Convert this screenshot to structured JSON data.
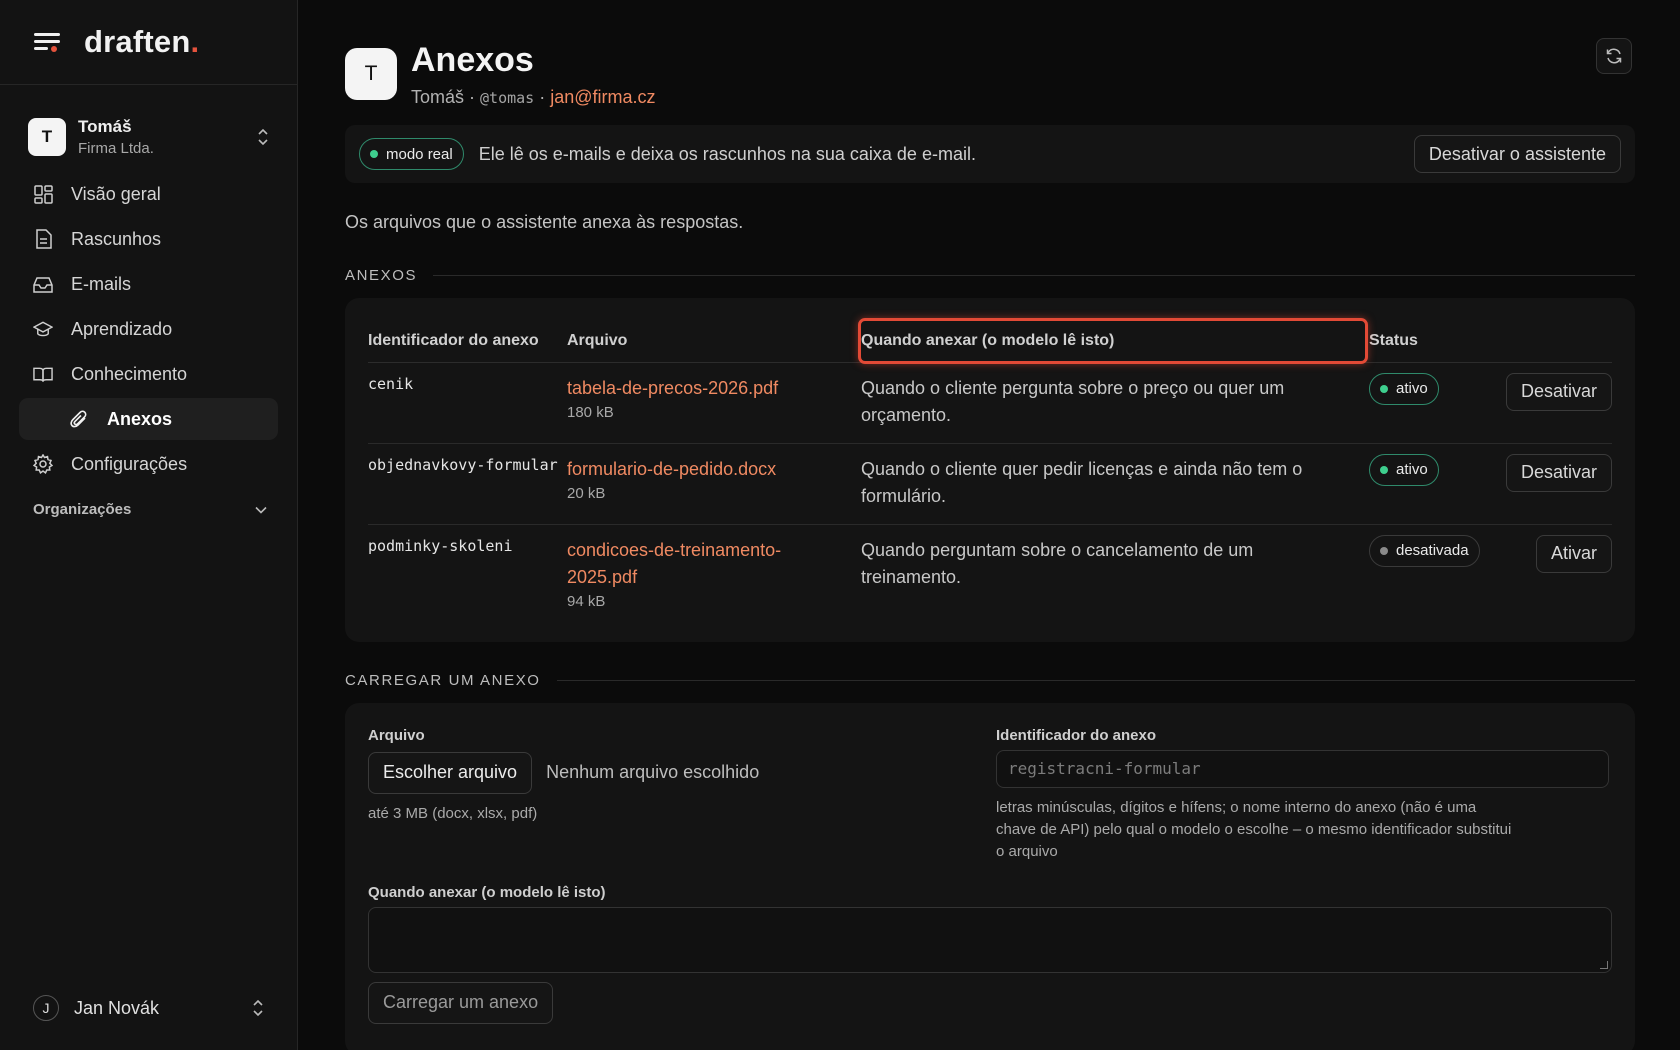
{
  "brand": {
    "name": "draften",
    "dot": "."
  },
  "account": {
    "initial": "T",
    "name": "Tomáš",
    "org": "Firma Ltda."
  },
  "nav": [
    {
      "label": "Visão geral",
      "icon": "dashboard-icon"
    },
    {
      "label": "Rascunhos",
      "icon": "document-icon"
    },
    {
      "label": "E-mails",
      "icon": "inbox-icon"
    },
    {
      "label": "Aprendizado",
      "icon": "graduation-cap-icon"
    },
    {
      "label": "Conhecimento",
      "icon": "book-icon"
    },
    {
      "label": "Anexos",
      "icon": "paperclip-icon",
      "active": true
    },
    {
      "label": "Configurações",
      "icon": "gear-icon"
    }
  ],
  "orgs": {
    "label": "Organizações"
  },
  "user": {
    "initial": "J",
    "name": "Jan Novák"
  },
  "header": {
    "initial": "T",
    "title": "Anexos",
    "name": "Tomáš",
    "sep1": " · ",
    "handle": "@tomas",
    "sep2": " · ",
    "email": "jan@firma.cz"
  },
  "banner": {
    "mode": "modo real",
    "text": "Ele lê os e-mails e deixa os rascunhos na sua caixa de e-mail.",
    "button": "Desativar o assistente"
  },
  "intro": "Os arquivos que o assistente anexa às respostas.",
  "attachments_section": "ANEXOS",
  "table": {
    "headers": [
      "Identificador do anexo",
      "Arquivo",
      "Quando anexar (o modelo lê isto)",
      "Status"
    ],
    "rows": [
      {
        "id": "cenik",
        "file": "tabela-de-precos-2026.pdf",
        "size": "180 kB",
        "when": "Quando o cliente pergunta sobre o preço ou quer um orçamento.",
        "status": "ativo",
        "action": "Desativar"
      },
      {
        "id": "objednavkovy-formular",
        "file": "formulario-de-pedido.docx",
        "size": "20 kB",
        "when": "Quando o cliente quer pedir licenças e ainda não tem o formulário.",
        "status": "ativo",
        "action": "Desativar"
      },
      {
        "id": "podminky-skoleni",
        "file": "condicoes-de-treinamento-2025.pdf",
        "size": "94 kB",
        "when": "Quando perguntam sobre o cancelamento de um treinamento.",
        "status": "desativada",
        "action": "Ativar"
      }
    ]
  },
  "upload_section": "CARREGAR UM ANEXO",
  "upload": {
    "file_label": "Arquivo",
    "choose_button": "Escolher arquivo",
    "no_file": "Nenhum arquivo escolhido",
    "file_hint": "até 3 MB (docx, xlsx, pdf)",
    "id_label": "Identificador do anexo",
    "id_placeholder": "registracni-formular",
    "id_hint": "letras minúsculas, dígitos e hífens; o nome interno do anexo (não é uma chave de API) pelo qual o modelo o escolhe – o mesmo identificador substitui o arquivo",
    "when_label": "Quando anexar (o modelo lê isto)",
    "submit": "Carregar um anexo"
  },
  "colors": {
    "accent": "#e5533d",
    "link": "#f08a62",
    "active_green": "#3ecf8e",
    "highlight": "#e24a36"
  }
}
